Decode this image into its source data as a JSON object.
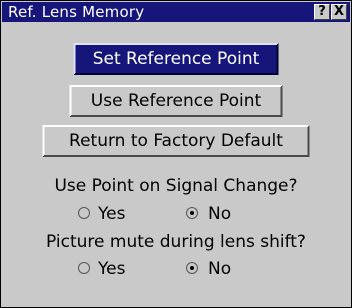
{
  "window": {
    "title": "Ref. Lens Memory",
    "help_label": "?",
    "close_label": "X"
  },
  "buttons": {
    "set_reference": "Set Reference Point",
    "use_reference": "Use Reference Point",
    "factory_default": "Return to Factory Default"
  },
  "signal_change": {
    "question": "Use Point on Signal Change?",
    "option_yes": "Yes",
    "option_no": "No",
    "selected": "No"
  },
  "picture_mute": {
    "question": "Picture mute during lens shift?",
    "option_yes": "Yes",
    "option_no": "No",
    "selected": "No"
  },
  "colors": {
    "titlebar": "#16167a",
    "panel": "#c9c9c9",
    "selected_button": "#16167a"
  }
}
